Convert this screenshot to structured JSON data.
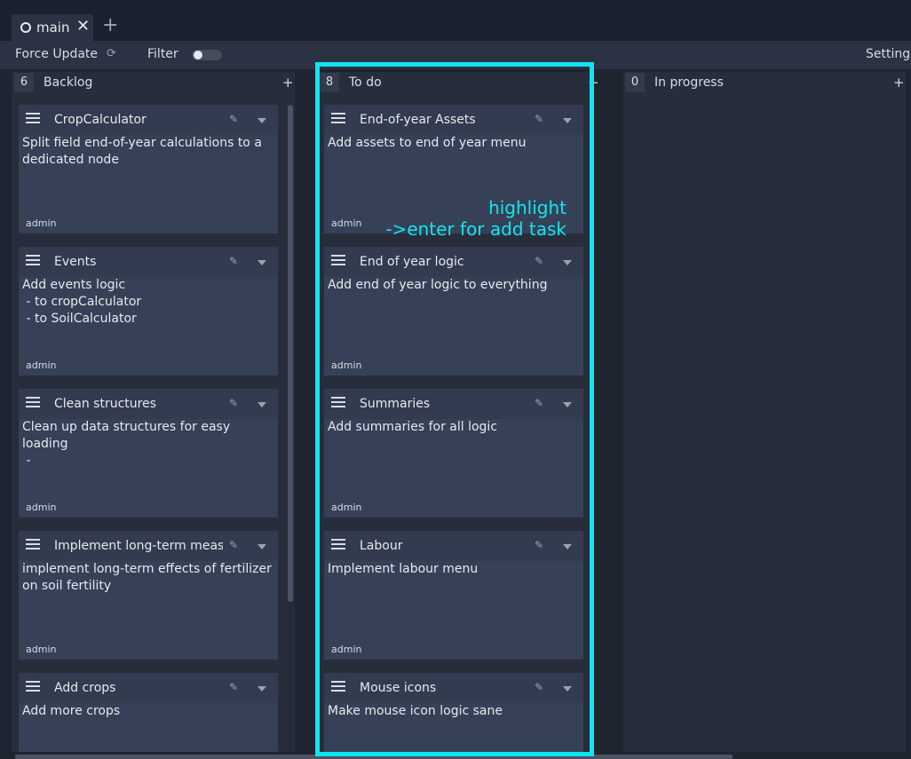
{
  "tabbar": {
    "tab_label": "main",
    "close_glyph": "✕",
    "add_glyph": "+"
  },
  "toolbar": {
    "force_update": "Force Update",
    "sync_icon": "⟳",
    "filter": "Filter",
    "settings": "Settings"
  },
  "columns": [
    {
      "count": "6",
      "title": "Backlog",
      "add": "+"
    },
    {
      "count": "8",
      "title": "To do",
      "add": "+"
    },
    {
      "count": "0",
      "title": "In progress",
      "add": "+"
    }
  ],
  "backlog_cards": [
    {
      "title": "CropCalculator",
      "desc": "Split field end-of-year calculations to a dedicated node",
      "owner": "admin"
    },
    {
      "title": "Events",
      "desc": "Add events logic\n - to cropCalculator\n - to SoilCalculator",
      "owner": "admin"
    },
    {
      "title": "Clean structures",
      "desc": "Clean up data structures for easy loading\n -",
      "owner": "admin"
    },
    {
      "title": "Implement long-term meas",
      "desc": "implement long-term effects of fertilizer on soil fertility",
      "owner": "admin"
    },
    {
      "title": "Add crops",
      "desc": "Add more crops",
      "owner": ""
    }
  ],
  "todo_cards": [
    {
      "title": "End-of-year Assets",
      "desc": "Add assets to end of year menu",
      "owner": "admin"
    },
    {
      "title": "End of year logic",
      "desc": "Add end of year logic to everything",
      "owner": "admin"
    },
    {
      "title": "Summaries",
      "desc": "Add summaries for all logic",
      "owner": "admin"
    },
    {
      "title": "Labour",
      "desc": "Implement labour menu",
      "owner": "admin"
    },
    {
      "title": "Mouse icons",
      "desc": "Make mouse icon logic sane",
      "owner": ""
    }
  ],
  "card_icons": {
    "edit": "✎",
    "task": "task-list-icon"
  },
  "annotation": {
    "line1": "highlight",
    "line2": "->enter for add task"
  },
  "colors": {
    "highlight": "#10e6f0",
    "background": "#1f2431",
    "card": "#364056"
  }
}
